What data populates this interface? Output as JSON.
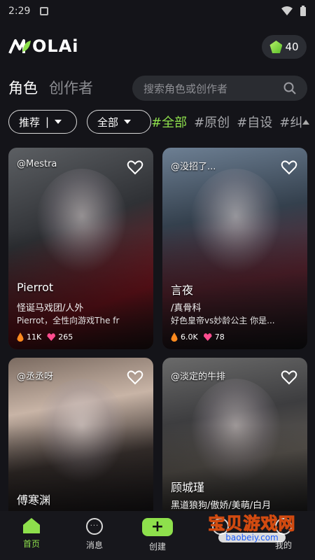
{
  "status_bar": {
    "time": "2:29"
  },
  "header": {
    "logo_text": "OLAi",
    "coin_count": "40"
  },
  "tabs": [
    {
      "label": "角色",
      "active": true
    },
    {
      "label": "创作者",
      "active": false
    }
  ],
  "search": {
    "placeholder": "搜索角色或创作者"
  },
  "filters": {
    "sort_label": "推荐",
    "sort_divider": "|",
    "category_label": "全部",
    "tags": [
      "#全部",
      "#原创",
      "#自设",
      "#纠"
    ]
  },
  "cards": [
    {
      "creator": "@Mestra",
      "name": "Pierrot",
      "tag": "怪诞马戏团/人外",
      "desc": "Pierrot，全性向游戏The fr",
      "hot": "11K",
      "likes": "265"
    },
    {
      "creator": "@没招了...",
      "name": "言夜",
      "tag": "/真骨科",
      "desc": "好色皇帝vs妙龄公主 你是...",
      "hot": "6.0K",
      "likes": "78"
    },
    {
      "creator": "@丞丞呀",
      "name": "傅寒渊",
      "tag": "",
      "desc": "",
      "hot": "",
      "likes": ""
    },
    {
      "creator": "@淡定的牛排",
      "name": "顾城瑾",
      "tag": "黑道狼狗/傲娇/美萌/白月",
      "desc": "",
      "hot": "",
      "likes": ""
    }
  ],
  "nav": [
    {
      "label": "首页",
      "active": true
    },
    {
      "label": "消息",
      "active": false
    },
    {
      "label": "创建",
      "active": false
    },
    {
      "label": "",
      "active": false
    },
    {
      "label": "我的",
      "active": false
    }
  ],
  "watermark": {
    "main": "宝贝游戏网",
    "sub": "baobeiy.com"
  },
  "colors": {
    "accent": "#8ee04c",
    "background": "#141419"
  }
}
